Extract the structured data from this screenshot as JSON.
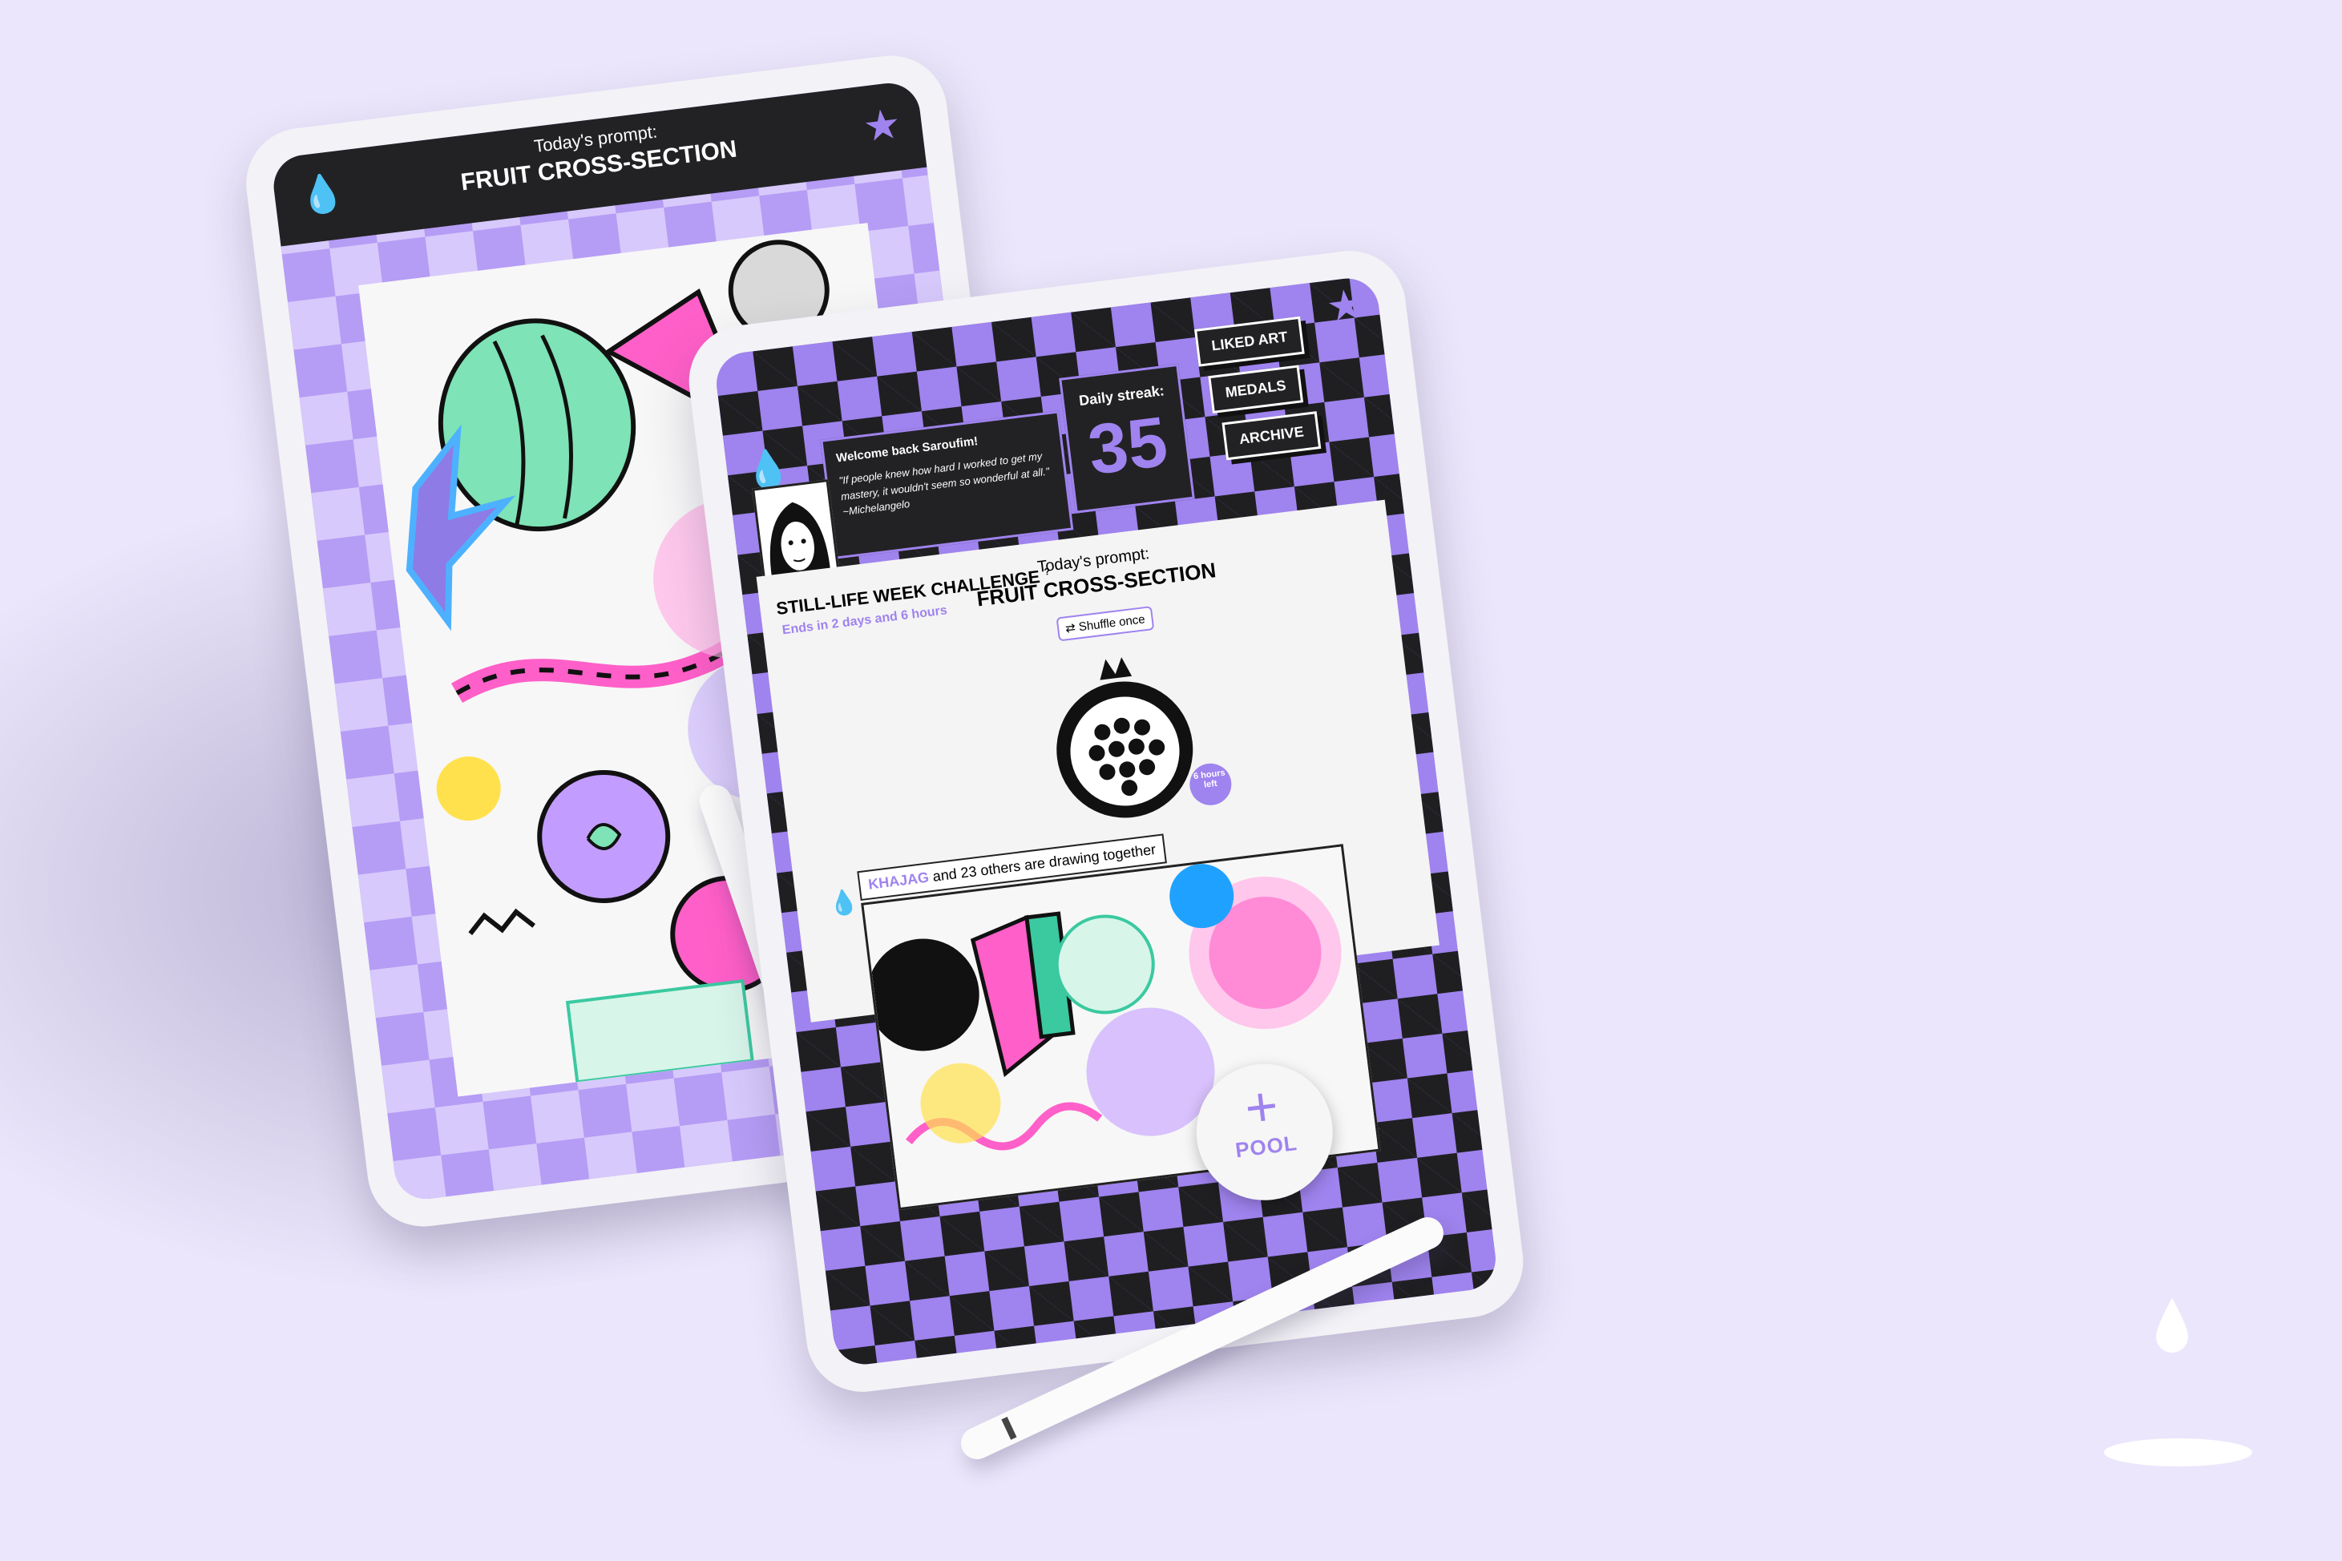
{
  "back_tablet": {
    "prompt_label": "Today's prompt:",
    "prompt_title": "FRUIT CROSS-SECTION"
  },
  "front_tablet": {
    "greeting": "Welcome back Saroufim!",
    "quote": "\"If people knew how hard I worked to get my mastery, it wouldn't seem so wonderful at all.\" ~Michelangelo",
    "streak": {
      "label": "Daily streak:",
      "value": "35"
    },
    "nav": [
      "LIKED ART",
      "MEDALS",
      "ARCHIVE"
    ],
    "challenge": {
      "title": "STILL-LIFE WEEK CHALLENGE",
      "help": "?",
      "ends": "Ends in 2 days and 6 hours"
    },
    "prompt": {
      "label": "Today's prompt:",
      "title": "FRUIT CROSS-SECTION",
      "shuffle": "Shuffle once"
    },
    "timer_badge": "6 hours left",
    "collab": {
      "user": "KHAJAG",
      "text": " and 23 others are drawing together"
    },
    "pool": {
      "plus": "+",
      "label": "POOL"
    }
  },
  "colors": {
    "accent": "#9f83ee",
    "dark": "#222224",
    "background": "#ebe6fb"
  },
  "icons": [
    "drop-icon",
    "star-icon",
    "shuffle-icon",
    "pomegranate-icon",
    "plus-icon"
  ]
}
